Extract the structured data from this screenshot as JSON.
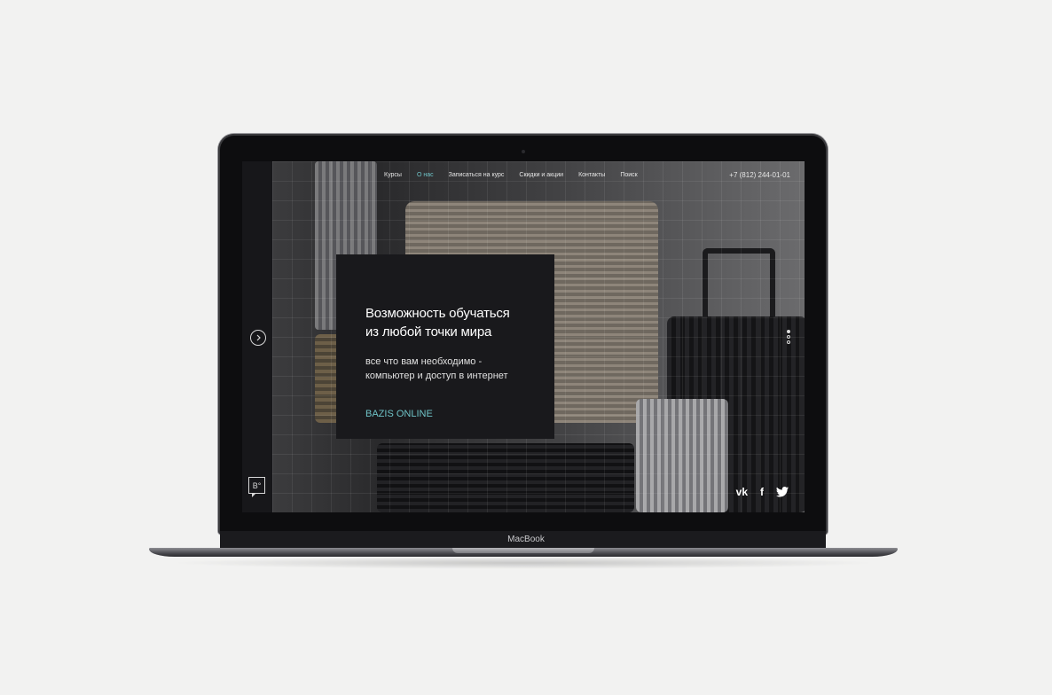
{
  "device": {
    "brand": "MacBook"
  },
  "site": {
    "nav": [
      {
        "label": "Курсы",
        "active": false
      },
      {
        "label": "О нас",
        "active": true
      },
      {
        "label": "Записаться на курс",
        "active": false
      },
      {
        "label": "Скидки и акции",
        "active": false
      },
      {
        "label": "Контакты",
        "active": false
      },
      {
        "label": "Поиск",
        "active": false
      }
    ],
    "phone": "+7 (812) 244-01-01",
    "hero": {
      "title_line1": "Возможность обучаться",
      "title_line2": "из любой точки мира",
      "subtitle_line1": "все что вам необходимо -",
      "subtitle_line2": "компьютер и доступ в интернет",
      "link": "BAZIS ONLINE"
    },
    "logo_text": "B°",
    "pager": {
      "total": 3,
      "current": 1
    },
    "social": [
      "vk-icon",
      "facebook-icon",
      "twitter-icon"
    ],
    "colors": {
      "accent": "#6fc3c7",
      "card_bg": "#19191c"
    }
  }
}
